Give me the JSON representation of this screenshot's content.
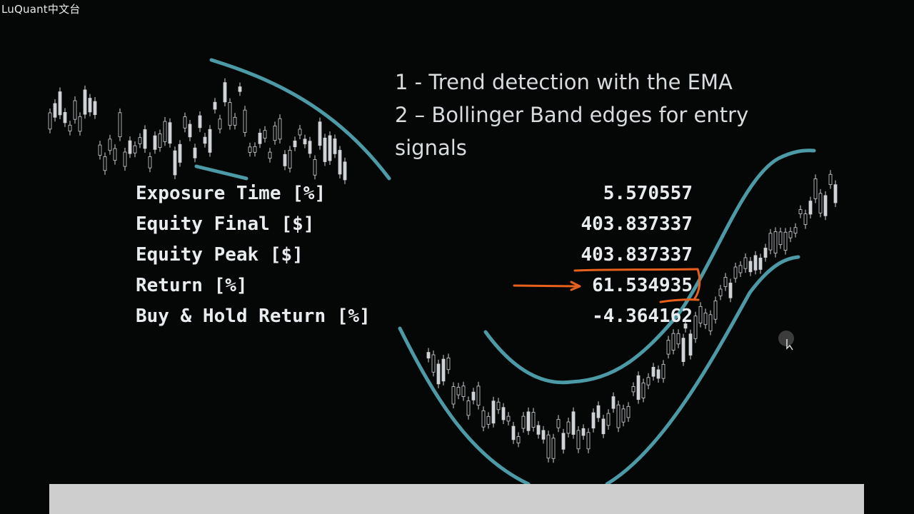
{
  "watermark": "LuQuant中文台",
  "bullets": [
    "1 - Trend detection with the EMA",
    "2 – Bollinger Band edges for entry",
    "signals"
  ],
  "stats": [
    {
      "label": "Exposure Time [%]",
      "value": "5.570557"
    },
    {
      "label": "Equity Final [$]",
      "value": "403.837337"
    },
    {
      "label": "Equity Peak [$]",
      "value": "403.837337"
    },
    {
      "label": "Return [%]",
      "value": "61.534935"
    },
    {
      "label": "Buy & Hold Return [%]",
      "value": "-4.364162"
    }
  ],
  "colors": {
    "background": "#050606",
    "band": "#4b9aa6",
    "candle": "#cfd3d6",
    "highlight": "#e8611c",
    "text": "#e9ecef",
    "bottom_bar": "#cdcecd"
  }
}
